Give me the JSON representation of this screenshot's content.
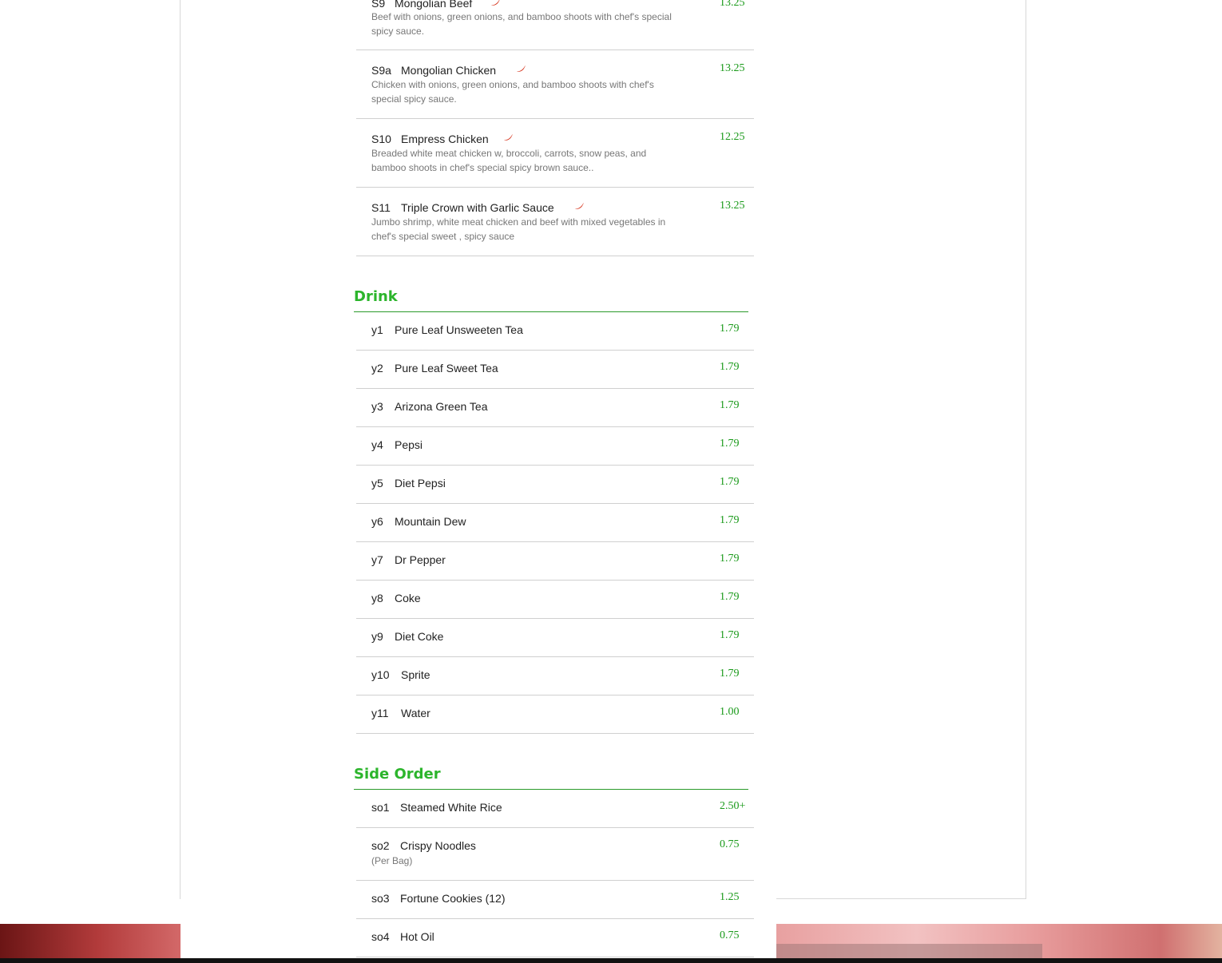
{
  "specials": [
    {
      "code": "S9",
      "name": "Mongolian Beef",
      "spicy": true,
      "price": "13.25",
      "desc": "Beef with onions, green onions, and bamboo shoots with chef's special spicy sauce."
    },
    {
      "code": "S9a",
      "name": "Mongolian Chicken",
      "spicy": true,
      "price": "13.25",
      "desc": "Chicken with onions, green onions, and bamboo shoots with chef's special spicy sauce."
    },
    {
      "code": "S10",
      "name": "Empress Chicken",
      "spicy": true,
      "price": "12.25",
      "desc": "Breaded white meat chicken w, broccoli, carrots, snow peas, and bamboo shoots in chef's special spicy brown sauce.."
    },
    {
      "code": "S11",
      "name": "Triple Crown with Garlic Sauce",
      "spicy": true,
      "price": "13.25",
      "desc": "Jumbo shrimp, white meat chicken and beef with mixed vegetables in chef's special sweet , spicy sauce"
    }
  ],
  "drink": {
    "title": "Drink",
    "items": [
      {
        "code": "y1",
        "name": "Pure Leaf Unsweeten Tea",
        "price": "1.79"
      },
      {
        "code": "y2",
        "name": "Pure Leaf Sweet Tea",
        "price": "1.79"
      },
      {
        "code": "y3",
        "name": "Arizona Green Tea",
        "price": "1.79"
      },
      {
        "code": "y4",
        "name": "Pepsi",
        "price": "1.79"
      },
      {
        "code": "y5",
        "name": "Diet Pepsi",
        "price": "1.79"
      },
      {
        "code": "y6",
        "name": "Mountain Dew",
        "price": "1.79"
      },
      {
        "code": "y7",
        "name": "Dr Pepper",
        "price": "1.79"
      },
      {
        "code": "y8",
        "name": "Coke",
        "price": "1.79"
      },
      {
        "code": "y9",
        "name": "Diet Coke",
        "price": "1.79"
      },
      {
        "code": "y10",
        "name": "Sprite",
        "price": "1.79"
      },
      {
        "code": "y11",
        "name": "Water",
        "price": "1.00"
      }
    ]
  },
  "side_order": {
    "title": "Side Order",
    "items": [
      {
        "code": "so1",
        "name": "Steamed White Rice",
        "price": "2.50+"
      },
      {
        "code": "so2",
        "name": "Crispy Noodles",
        "price": "0.75",
        "desc": "(Per Bag)"
      },
      {
        "code": "so3",
        "name": "Fortune Cookies (12)",
        "price": "1.25"
      },
      {
        "code": "so4",
        "name": "Hot Oil",
        "price": "0.75"
      }
    ]
  },
  "colors": {
    "accent": "#2cb52c",
    "price": "#1a9a1a",
    "pepper": "#d42a12"
  },
  "icons": {
    "spicy": "chili-pepper-icon"
  }
}
